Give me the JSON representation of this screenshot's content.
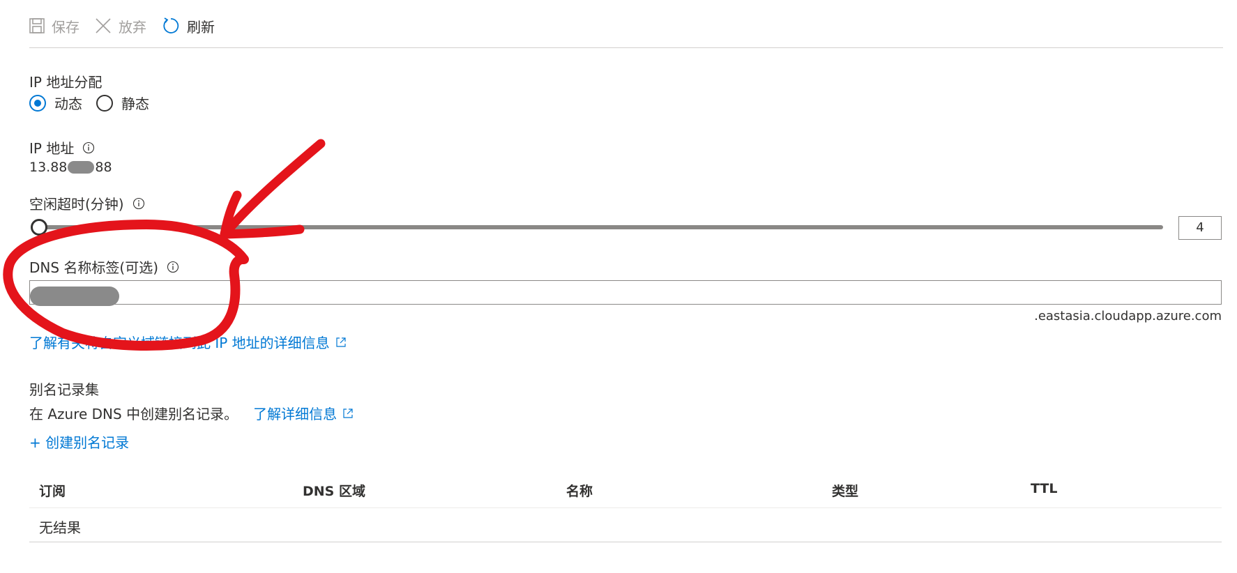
{
  "toolbar": {
    "save_label": "保存",
    "discard_label": "放弃",
    "refresh_label": "刷新"
  },
  "ip_assignment": {
    "label": "IP 地址分配",
    "options": [
      "动态",
      "静态"
    ],
    "selected": "动态"
  },
  "ip_address": {
    "label": "IP 地址",
    "value_prefix": "13.88",
    "value_suffix": "88"
  },
  "idle_timeout": {
    "label": "空闲超时(分钟)",
    "value": "4",
    "min": 4,
    "max": 30
  },
  "dns_label": {
    "label": "DNS 名称标签(可选)",
    "value": "",
    "suffix": ".eastasia.cloudapp.azure.com"
  },
  "learn_more_dns": {
    "text": "了解有关将自定义域链接到此 IP 地址的详细信息"
  },
  "alias_records": {
    "title": "别名记录集",
    "description": "在 Azure DNS 中创建别名记录。",
    "learn_more": "了解详细信息",
    "create_link": "+ 创建别名记录"
  },
  "table": {
    "columns": [
      "订阅",
      "DNS 区域",
      "名称",
      "类型",
      "TTL"
    ],
    "empty_text": "无结果"
  },
  "colors": {
    "accent": "#0078d4",
    "annotation": "#e4141b",
    "text": "#323130",
    "disabled": "#a19f9d"
  }
}
